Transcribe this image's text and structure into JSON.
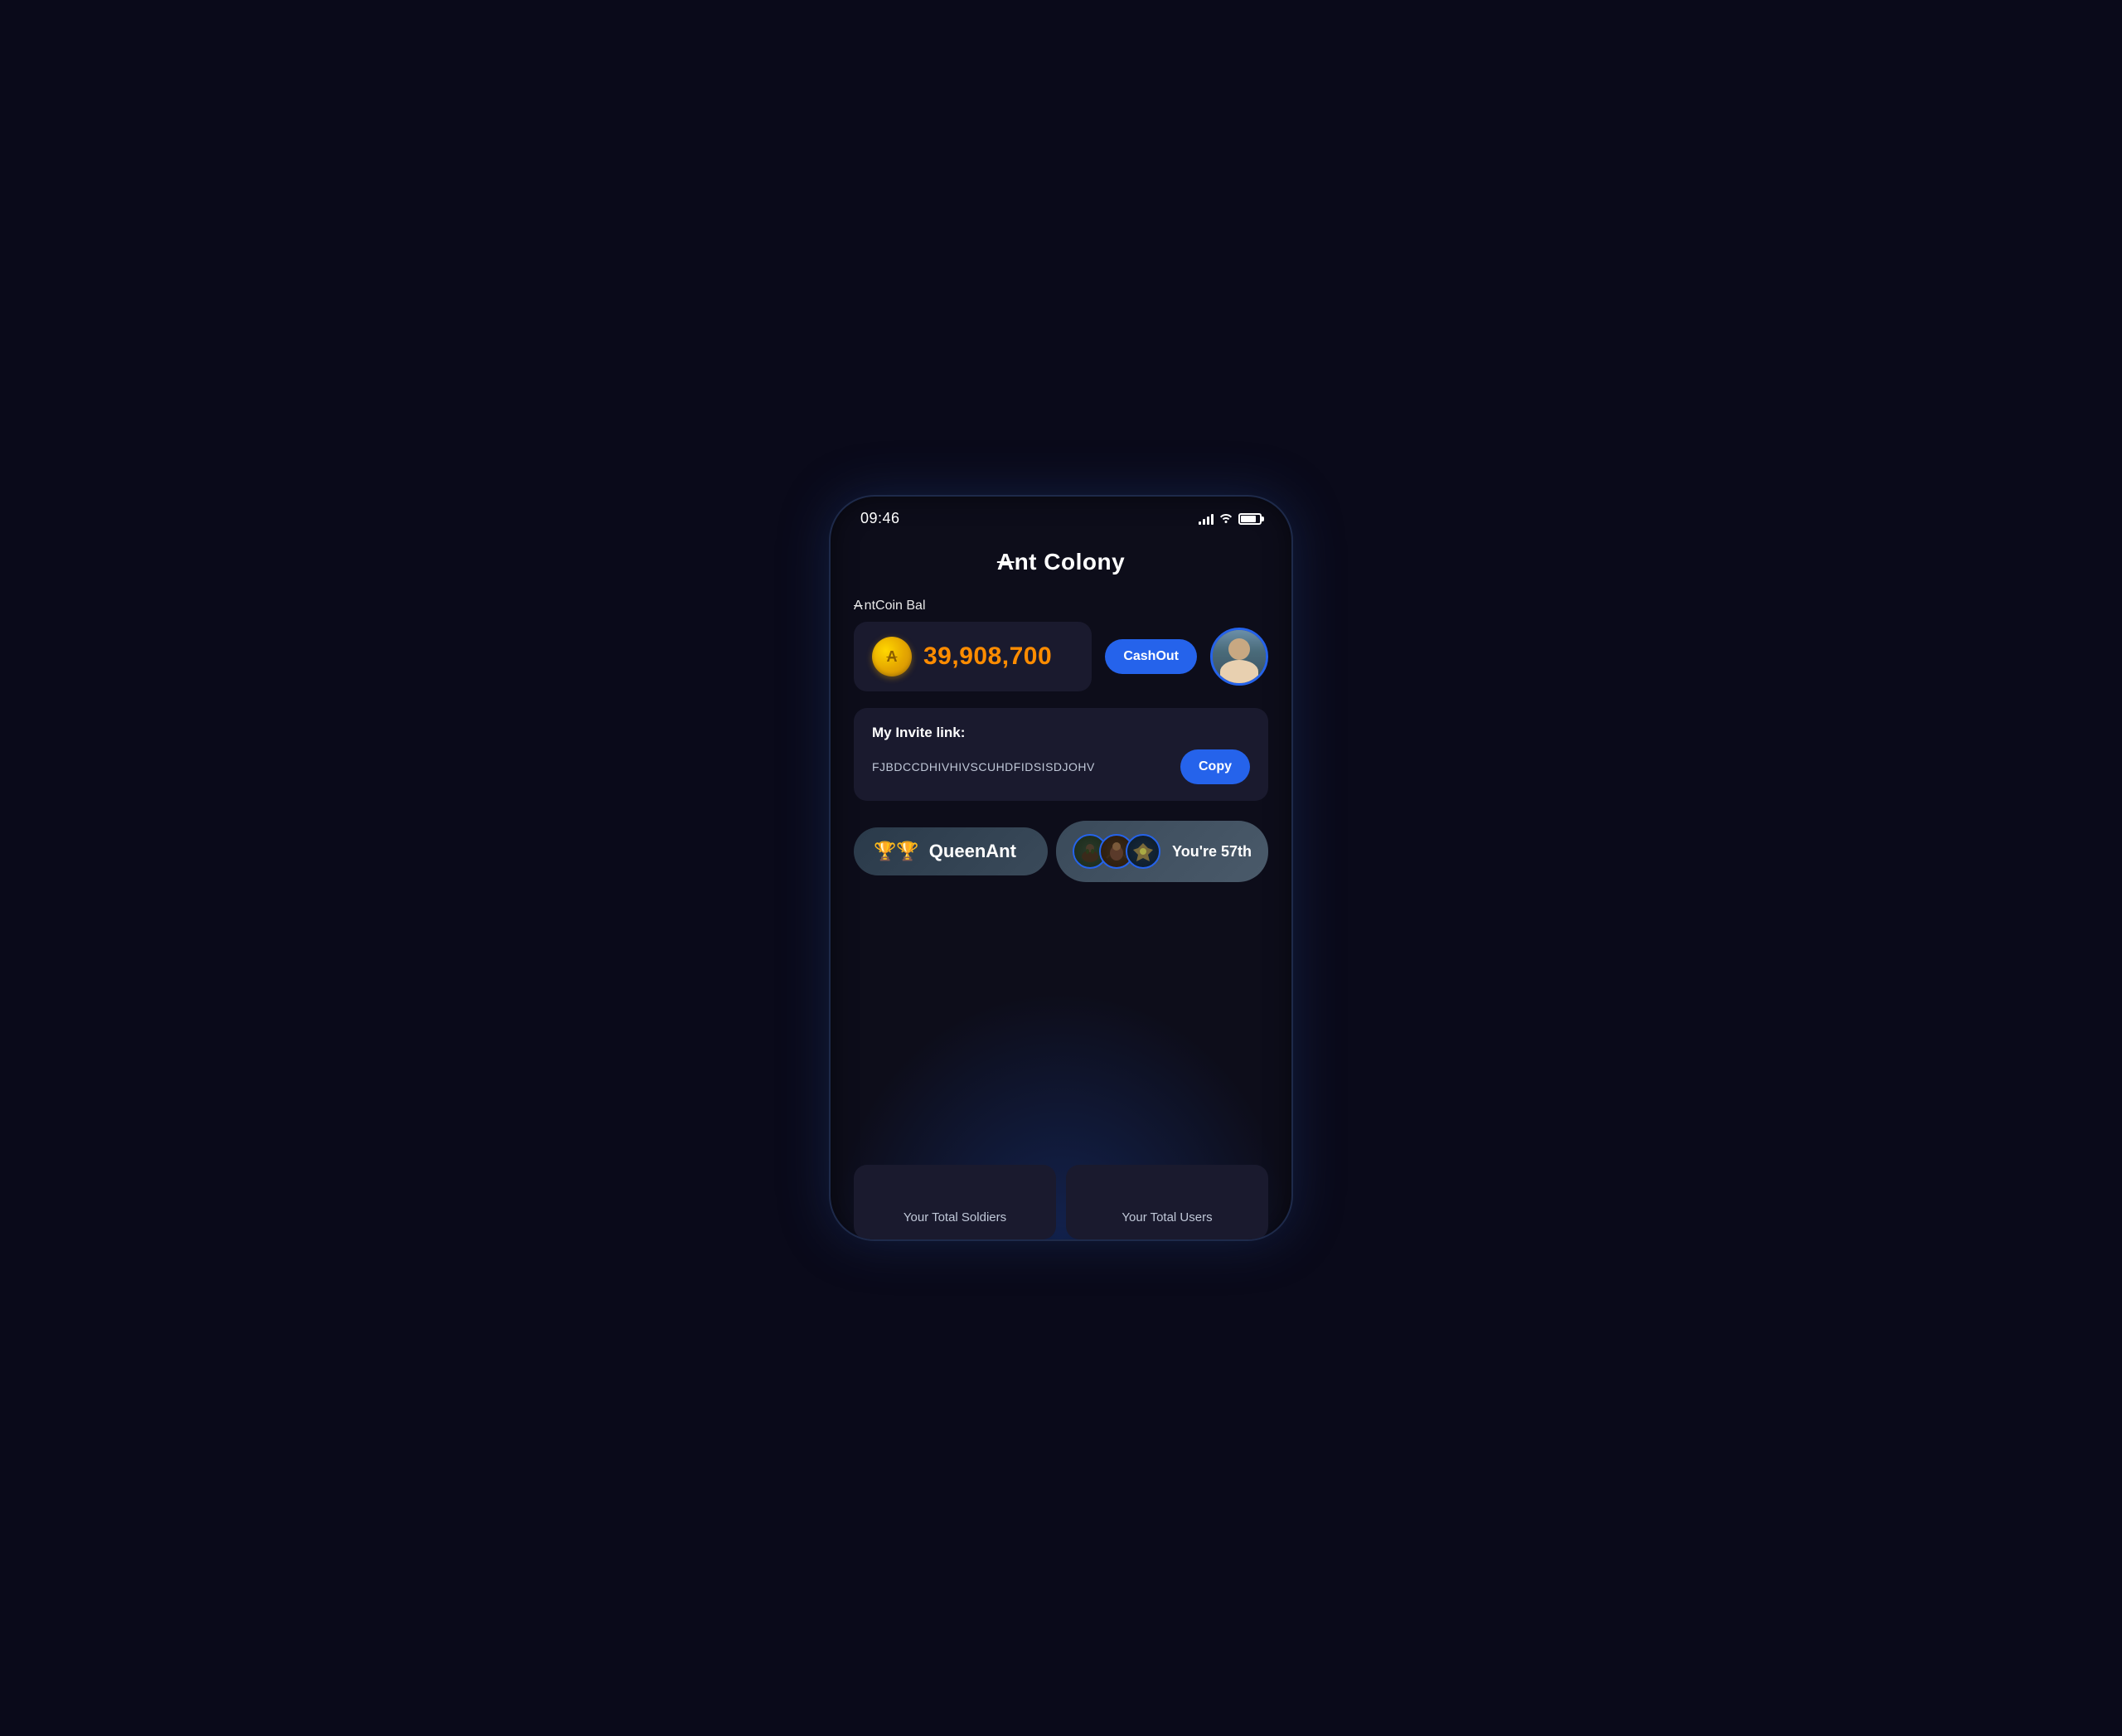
{
  "statusBar": {
    "time": "09:46",
    "batteryLevel": 80
  },
  "header": {
    "title": "Ant Colony",
    "antSymbol": "A"
  },
  "balance": {
    "label": "AntCoin Bal",
    "antSymbol": "A",
    "amount": "39,908,700",
    "cashoutLabel": "CashOut"
  },
  "inviteLink": {
    "title": "My Invite link:",
    "code": "FJBDCCDHIVHIVSCUHDFIDSISDJOHV",
    "copyLabel": "Copy"
  },
  "queenAnt": {
    "label": "QueenAnt",
    "rankText": "You're 57th",
    "trophyEmoji": "🏆",
    "avatarEmojis": [
      "🐜",
      "🐛",
      "🦎"
    ]
  },
  "stats": {
    "soldiers": {
      "label": "Your Total Soldiers"
    },
    "users": {
      "label": "Your Total Users"
    }
  }
}
